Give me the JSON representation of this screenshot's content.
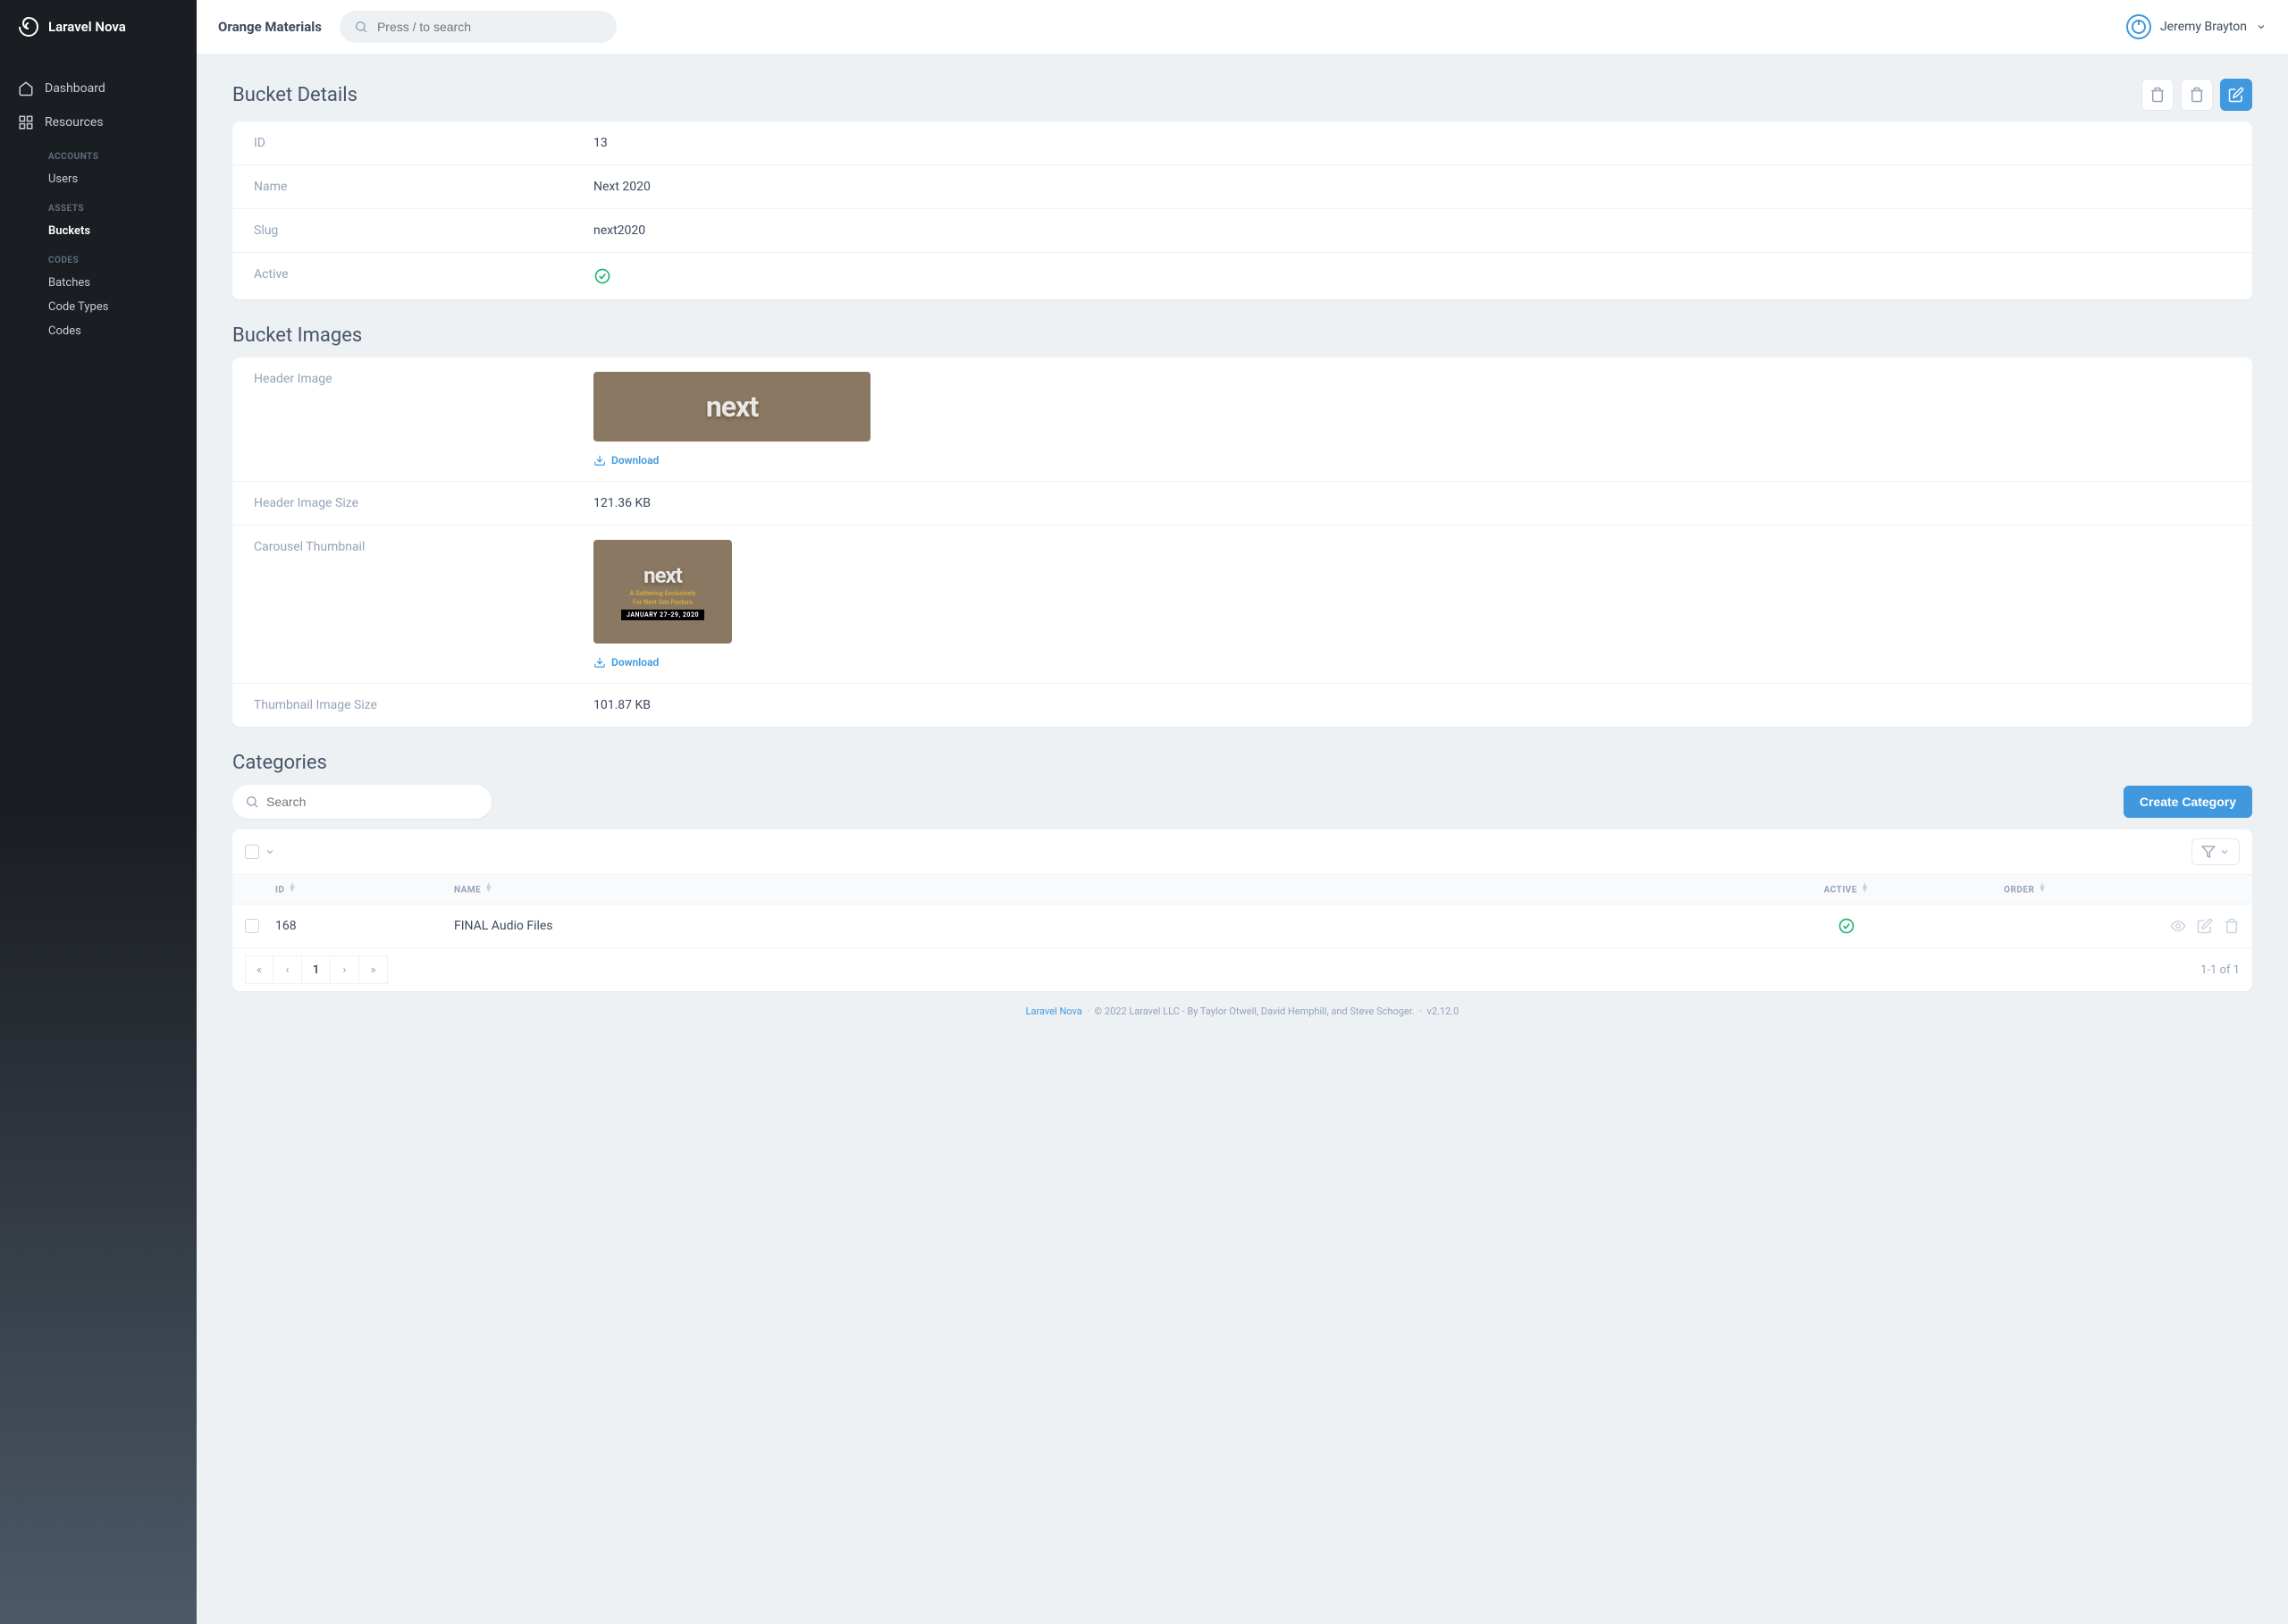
{
  "brand": "Laravel Nova",
  "app_title": "Orange Materials",
  "search": {
    "placeholder": "Press / to search"
  },
  "user": {
    "name": "Jeremy Brayton"
  },
  "sidebar": {
    "dashboard": "Dashboard",
    "resources": "Resources",
    "groups": {
      "accounts": {
        "label": "ACCOUNTS",
        "items": [
          "Users"
        ]
      },
      "assets": {
        "label": "ASSETS",
        "items": [
          "Buckets"
        ]
      },
      "codes": {
        "label": "CODES",
        "items": [
          "Batches",
          "Code Types",
          "Codes"
        ]
      }
    }
  },
  "sections": {
    "bucket_details": {
      "title": "Bucket Details",
      "rows": {
        "id": {
          "label": "ID",
          "value": "13"
        },
        "name": {
          "label": "Name",
          "value": "Next 2020"
        },
        "slug": {
          "label": "Slug",
          "value": "next2020"
        },
        "active": {
          "label": "Active",
          "value": true
        }
      }
    },
    "bucket_images": {
      "title": "Bucket Images",
      "header_image": {
        "label": "Header Image",
        "download": "Download",
        "logo_text": "next"
      },
      "header_size": {
        "label": "Header Image Size",
        "value": "121.36 KB"
      },
      "carousel": {
        "label": "Carousel Thumbnail",
        "download": "Download",
        "logo_text": "next",
        "sub1": "A Gathering Exclusively",
        "sub2": "For Next Gen Pastors",
        "date": "JANUARY 27-29, 2020"
      },
      "thumb_size": {
        "label": "Thumbnail Image Size",
        "value": "101.87 KB"
      }
    },
    "categories": {
      "title": "Categories",
      "search_placeholder": "Search",
      "create_label": "Create Category",
      "columns": {
        "id": "ID",
        "name": "NAME",
        "active": "ACTIVE",
        "order": "ORDER"
      },
      "rows": [
        {
          "id": "168",
          "name": "FINAL Audio Files",
          "active": true
        }
      ],
      "pagination": {
        "first": "«",
        "prev": "‹",
        "current": "1",
        "next": "›",
        "last": "»",
        "info": "1-1 of 1"
      }
    }
  },
  "footer": {
    "link": "Laravel Nova",
    "copyright": "© 2022 Laravel LLC - By Taylor Otwell, David Hemphill, and Steve Schoger.",
    "version": "v2.12.0"
  }
}
